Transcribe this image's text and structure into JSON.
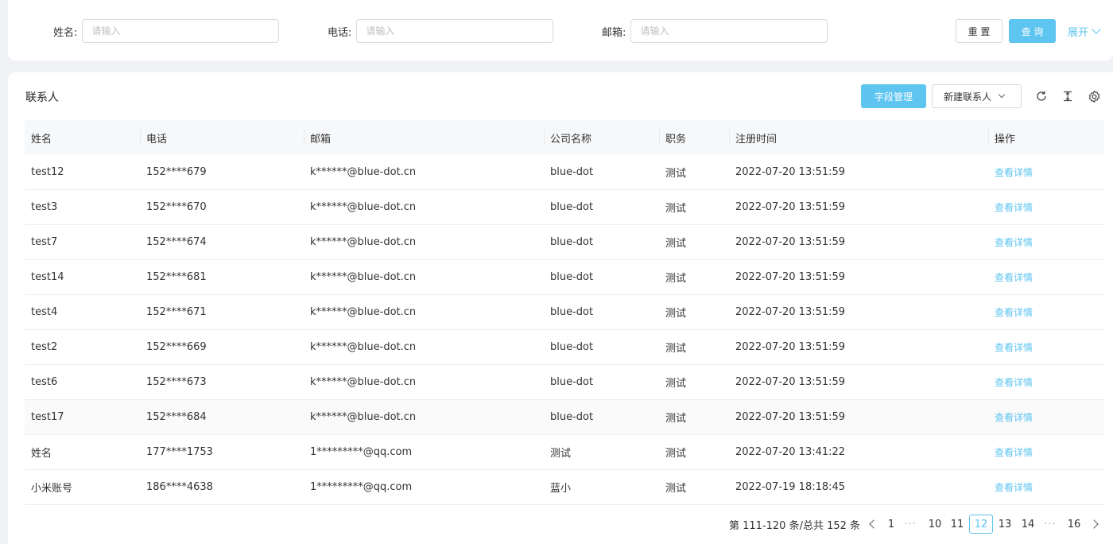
{
  "search": {
    "name_label": "姓名:",
    "name_placeholder": "请输入",
    "phone_label": "电话:",
    "phone_placeholder": "请输入",
    "email_label": "邮箱:",
    "email_placeholder": "请输入",
    "reset_label": "重 置",
    "query_label": "查 询",
    "expand_label": "展开"
  },
  "toolbar": {
    "title": "联系人",
    "field_manage_label": "字段管理",
    "new_contact_label": "新建联系人",
    "icons": [
      "refresh-icon",
      "column-height-icon",
      "settings-icon"
    ]
  },
  "table": {
    "columns": [
      "姓名",
      "电话",
      "邮箱",
      "公司名称",
      "职务",
      "注册时间",
      "操作"
    ],
    "action_label": "查看详情",
    "rows": [
      {
        "name": "test12",
        "phone": "152****679",
        "email": "k******@blue-dot.cn",
        "company": "blue-dot",
        "title": "测试",
        "time": "2022-07-20 13:51:59"
      },
      {
        "name": "test3",
        "phone": "152****670",
        "email": "k******@blue-dot.cn",
        "company": "blue-dot",
        "title": "测试",
        "time": "2022-07-20 13:51:59"
      },
      {
        "name": "test7",
        "phone": "152****674",
        "email": "k******@blue-dot.cn",
        "company": "blue-dot",
        "title": "测试",
        "time": "2022-07-20 13:51:59"
      },
      {
        "name": "test14",
        "phone": "152****681",
        "email": "k******@blue-dot.cn",
        "company": "blue-dot",
        "title": "测试",
        "time": "2022-07-20 13:51:59"
      },
      {
        "name": "test4",
        "phone": "152****671",
        "email": "k******@blue-dot.cn",
        "company": "blue-dot",
        "title": "测试",
        "time": "2022-07-20 13:51:59"
      },
      {
        "name": "test2",
        "phone": "152****669",
        "email": "k******@blue-dot.cn",
        "company": "blue-dot",
        "title": "测试",
        "time": "2022-07-20 13:51:59"
      },
      {
        "name": "test6",
        "phone": "152****673",
        "email": "k******@blue-dot.cn",
        "company": "blue-dot",
        "title": "测试",
        "time": "2022-07-20 13:51:59"
      },
      {
        "name": "test17",
        "phone": "152****684",
        "email": "k******@blue-dot.cn",
        "company": "blue-dot",
        "title": "测试",
        "time": "2022-07-20 13:51:59"
      },
      {
        "name": "姓名",
        "phone": "177****1753",
        "email": "1*********@qq.com",
        "company": "测试",
        "title": "测试",
        "time": "2022-07-20 13:41:22"
      },
      {
        "name": "小米账号",
        "phone": "186****4638",
        "email": "1*********@qq.com",
        "company": "蓝小",
        "title": "测试",
        "time": "2022-07-19 18:18:45"
      }
    ]
  },
  "pagination": {
    "summary": "第 111-120 条/总共 152 条",
    "pages": [
      "1",
      "10",
      "11",
      "12",
      "13",
      "14",
      "16"
    ],
    "current": "12",
    "ellipsis": "···"
  },
  "colors": {
    "accent": "#5ec4f0",
    "background": "#f0f2f5"
  }
}
